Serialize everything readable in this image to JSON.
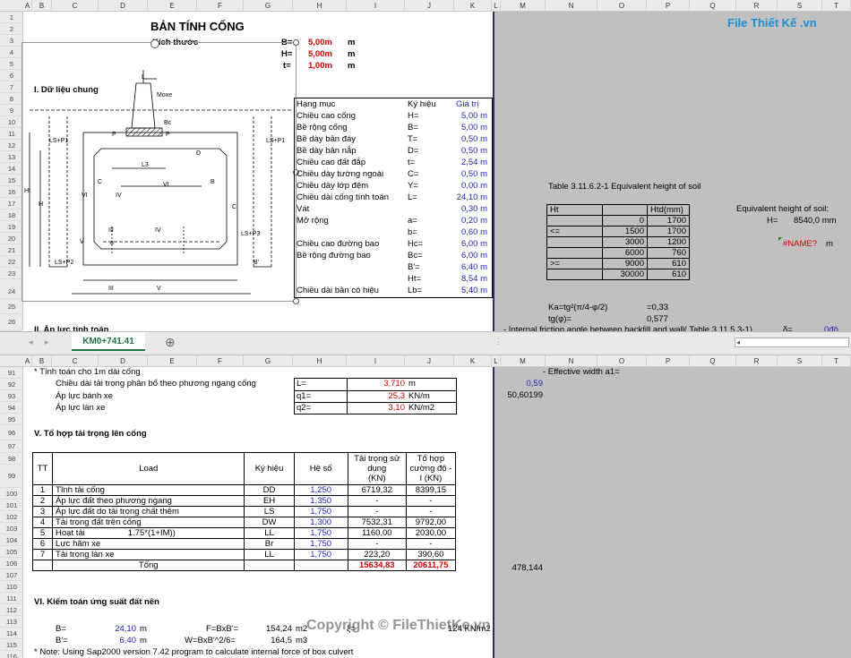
{
  "columns_top": [
    "A",
    "B",
    "C",
    "D",
    "E",
    "F",
    "G",
    "H",
    "I",
    "J",
    "K",
    "L",
    "M",
    "N",
    "O",
    "P",
    "Q",
    "R",
    "S",
    "T"
  ],
  "columns_bottom": [
    "A",
    "B",
    "C",
    "D",
    "E",
    "F",
    "G",
    "H",
    "I",
    "J",
    "K",
    "L",
    "M",
    "N",
    "O",
    "P",
    "Q",
    "R",
    "S",
    "T"
  ],
  "rows_top": [
    "1",
    "2",
    "3",
    "4",
    "5",
    "6",
    "7",
    "8",
    "9",
    "10",
    "11",
    "12",
    "13",
    "14",
    "15",
    "16",
    "17",
    "18",
    "19",
    "20",
    "21",
    "22",
    "23",
    "24",
    "25",
    "26"
  ],
  "rows_bottom": [
    "91",
    "92",
    "93",
    "94",
    "95",
    "96",
    "97",
    "98",
    "99",
    "100",
    "101",
    "102",
    "103",
    "104",
    "105",
    "106",
    "107",
    "110",
    "111",
    "112",
    "113",
    "114",
    "115",
    "116"
  ],
  "header": {
    "title": "BẢN TÍNH CỐNG",
    "dims_label": "Kích thước",
    "dims": [
      {
        "sym": "B=",
        "val": "5,00m",
        "unit": "m"
      },
      {
        "sym": "H=",
        "val": "5,00m",
        "unit": "m"
      },
      {
        "sym": "t=",
        "val": "1,00m",
        "unit": "m"
      }
    ]
  },
  "section1": "I.  Dữ liệu chung",
  "section2": "II. Áp lực tính toán",
  "drawing": {
    "labels": [
      "L",
      "Moxe",
      "Bc",
      "P",
      "P",
      "LS+P1",
      "LS+P1",
      "L3",
      "D",
      "Ht",
      "H",
      "C",
      "C",
      "B",
      "VI",
      "VI",
      "IV",
      "III",
      "IV",
      "III",
      "V",
      "V",
      "a",
      "LS+P3",
      "LS+P2",
      "B'"
    ]
  },
  "params": {
    "headers": [
      "Hạng mục",
      "Ký hiệu",
      "Giá trị"
    ],
    "rows": [
      {
        "name": "Chiều cao cống",
        "sym": "H=",
        "val": "5,00 m"
      },
      {
        "name": "Bề rộng cống",
        "sym": "B=",
        "val": "5,00 m"
      },
      {
        "name": "Bề dày bản đáy",
        "sym": "T=",
        "val": "0,50 m"
      },
      {
        "name": "Bề dày bản nắp",
        "sym": "D=",
        "val": "0,50 m"
      },
      {
        "name": "Chiều cao đất đắp",
        "sym": "t=",
        "val": "2,54 m"
      },
      {
        "name": "Chiều dày tường ngoài",
        "sym": "C=",
        "val": "0,50 m"
      },
      {
        "name": "Chiều dày lớp đệm",
        "sym": "Y=",
        "val": "0,00 m"
      },
      {
        "name": "Chiều dài cống tính toán",
        "sym": "L=",
        "val": "24,10 m"
      },
      {
        "name": "Vát",
        "sym": "",
        "val": "0,30 m"
      },
      {
        "name": "Mở rộng",
        "sym": "a=",
        "val": "0,20 m"
      },
      {
        "name": "",
        "sym": "b=",
        "val": "0,60 m"
      },
      {
        "name": "Chiều cao đường bao",
        "sym": "Hc=",
        "val": "6,00 m"
      },
      {
        "name": "Bề rộng đường bao",
        "sym": "Bc=",
        "val": "6,00 m"
      },
      {
        "name": "",
        "sym": "B'=",
        "val": "6,40 m"
      },
      {
        "name": "",
        "sym": "Ht=",
        "val": "8,54 m"
      },
      {
        "name": "Chiều dài bản có hiệu",
        "sym": "Lb=",
        "val": "5,40 m"
      }
    ]
  },
  "soil": {
    "caption": "Table 3.11.6.2-1 Equivalent height of soil",
    "headers": [
      "Ht",
      "",
      "Htd(mm)"
    ],
    "rows": [
      {
        "op": "",
        "a": "",
        "b": "0",
        "c": "1700"
      },
      {
        "op": "<=",
        "a": "",
        "b": "1500",
        "c": "1700"
      },
      {
        "op": "",
        "a": "",
        "b": "3000",
        "c": "1200"
      },
      {
        "op": "",
        "a": "",
        "b": "6000",
        "c": "760"
      },
      {
        "op": ">=",
        "a": "",
        "b": "9000",
        "c": "610"
      },
      {
        "op": "",
        "a": "",
        "b": "30000",
        "c": "610"
      }
    ],
    "eq_label": "Equivalent height of soil:",
    "eq_sym": "H=",
    "eq_val": "8540,0 mm",
    "name_err": "#NAME?",
    "name_unit": "m"
  },
  "ka": {
    "ka_label": "Ka=tg²(π/4-φ/2)",
    "ka_val": "=0,33",
    "tg_label": "tg(φ)=",
    "tg_val": "0,577",
    "friction": "- Internal friction angle between backfill and wall( Table 3.11.5.3-1)",
    "delta": "δ=",
    "deg": "0độ"
  },
  "tab": {
    "name": "KM0+741.41",
    "add": "⊕"
  },
  "bottom": {
    "note1": "* Tính toán cho 1m dài cống",
    "eff": "- Effective width a1=",
    "m92": "0,59",
    "m93": "50,60199",
    "lines": [
      {
        "label": "Chiều dài tải trọng phân bố theo phương ngang cống",
        "sym": "L=",
        "val": "3,710",
        "unit": "m"
      },
      {
        "label": "Áp lực bánh xe",
        "sym": "q1=",
        "val": "25,3",
        "unit": "KN/m"
      },
      {
        "label": "Áp lực làn xe",
        "sym": "q2=",
        "val": "3,10",
        "unit": "KN/m2"
      }
    ],
    "section5": "V. Tổ hợp tải trọng lên cống",
    "load_headers": [
      "TT",
      "Load",
      "Ký hiệu",
      "Hệ số",
      "Tải trọng sử dụng (KN)",
      "Tổ hợp cường độ - I  (KN)"
    ],
    "load_h_tt": "TT",
    "load_h_load": "Load",
    "load_h_sym": "Ký hiệu",
    "load_h_coef": "Hệ số",
    "load_h_use1": "Tải trọng sử",
    "load_h_use2": "dụng",
    "load_h_use3": "(KN)",
    "load_h_str1": "Tổ hợp",
    "load_h_str2": "cường độ -",
    "load_h_str3": "I  (KN)",
    "loads": [
      {
        "tt": "1",
        "name": "Tĩnh tải cống",
        "extra": "",
        "sym": "DD",
        "coef": "1,250",
        "use": "6719,32",
        "str": "8399,15"
      },
      {
        "tt": "2",
        "name": "Áp lực đất theo phương ngang",
        "extra": "",
        "sym": "EH",
        "coef": "1,350",
        "use": "-",
        "str": "-"
      },
      {
        "tt": "3",
        "name": "Áp lực đất do tải trọng chất thêm",
        "extra": "",
        "sym": "LS",
        "coef": "1,750",
        "use": "-",
        "str": "-"
      },
      {
        "tt": "4",
        "name": "Tải trọng đất trên cống",
        "extra": "",
        "sym": "DW",
        "coef": "1,300",
        "use": "7532,31",
        "str": "9792,00"
      },
      {
        "tt": "5",
        "name": "Hoạt tải",
        "extra": "1.75*(1+IM))",
        "sym": "LL",
        "coef": "1,750",
        "use": "1160,00",
        "str": "2030,00"
      },
      {
        "tt": "6",
        "name": "Lực hãm xe",
        "extra": "",
        "sym": "Br",
        "coef": "1,750",
        "use": "-",
        "str": "-"
      },
      {
        "tt": "7",
        "name": "Tải trọng làn xe",
        "extra": "",
        "sym": "LL",
        "coef": "1,750",
        "use": "223,20",
        "str": "390,60"
      }
    ],
    "m107": "478,144",
    "total_label": "Tổng",
    "total_use": "15634,83",
    "total_str": "20611,75",
    "section6": "VI. Kiểm toán ứng suất đất nền",
    "b_sym": "B=",
    "b_val": "24,10",
    "b_unit": "m",
    "f_label": "F=BxB'=",
    "f_val": "154,24",
    "f_unit": "m2",
    "b2_sym": "B'=",
    "b2_val": "6,40",
    "b2_unit": "m",
    "w_label": "W=BxB'^2/6=",
    "w_val": "164,5",
    "w_unit": "m3",
    "ksi": "ξ=",
    "ksi_val": "124 KN/m2",
    "note2": "* Note: Using Sap2000 version 7.42 program to calculate internal force of box culvert"
  },
  "watermark": "Copyright © FileThietKe.vn",
  "logo": "File Thiết Kế .vn"
}
